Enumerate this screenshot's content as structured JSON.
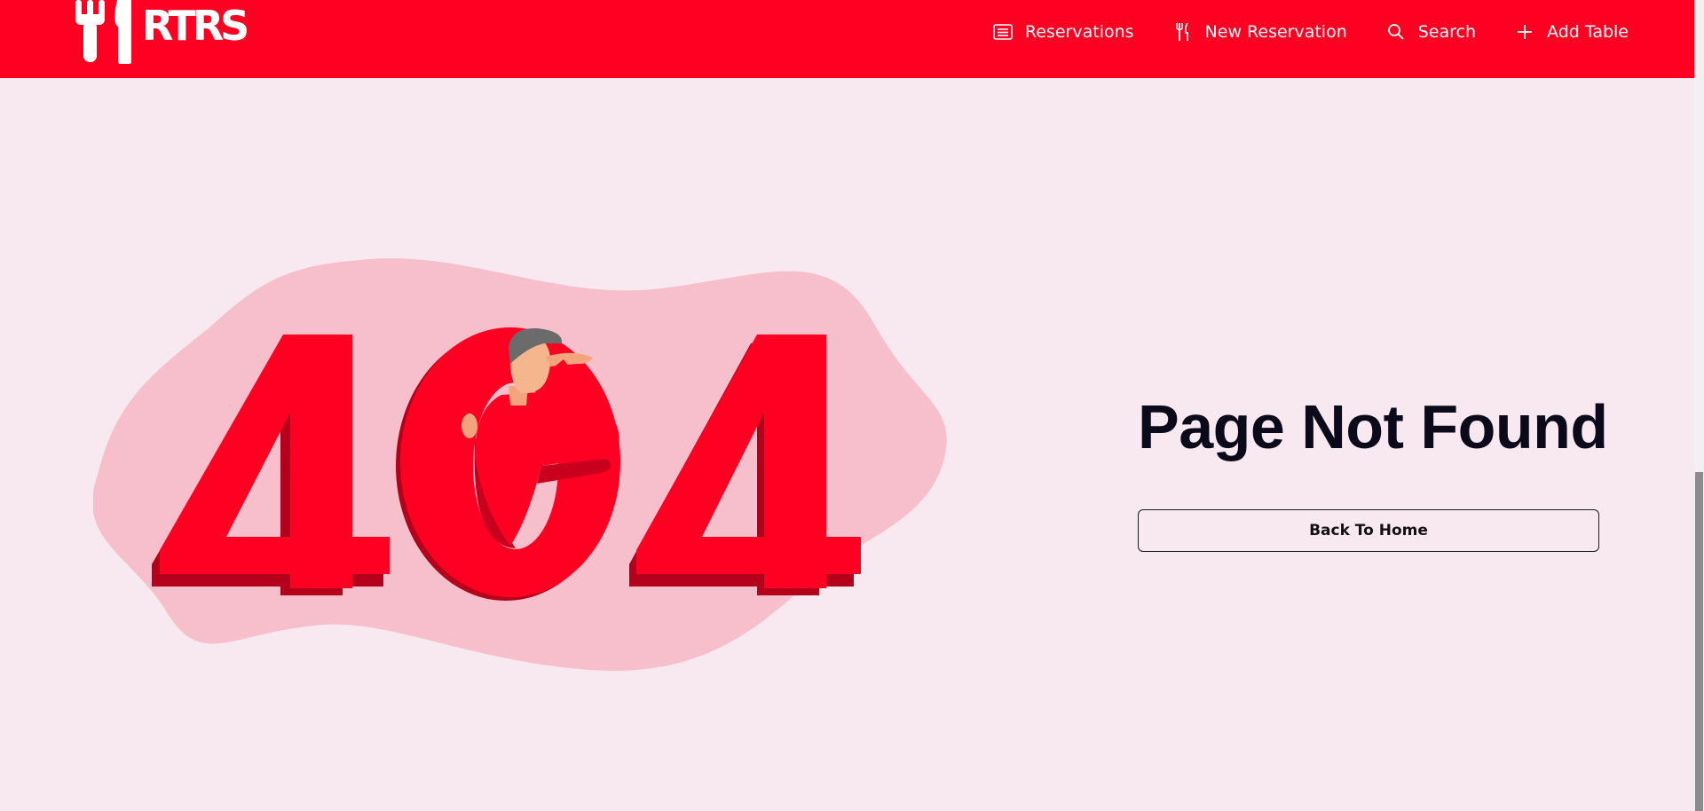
{
  "header": {
    "logo_text": "RTRS",
    "nav": [
      {
        "label": "Reservations",
        "icon": "list-icon"
      },
      {
        "label": "New Reservation",
        "icon": "fork-knife-icon"
      },
      {
        "label": "Search",
        "icon": "search-icon"
      },
      {
        "label": "Add Table",
        "icon": "plus-icon"
      }
    ]
  },
  "illustration": {
    "text": "404",
    "icon": "confused-man-404-illustration"
  },
  "main": {
    "title": "Page Not Found",
    "back_button_label": "Back To Home"
  },
  "colors": {
    "brand_red": "#ff0022",
    "background": "#f8e8f0",
    "blob": "#f7bfcc",
    "text_dark": "#0a0a1a"
  }
}
